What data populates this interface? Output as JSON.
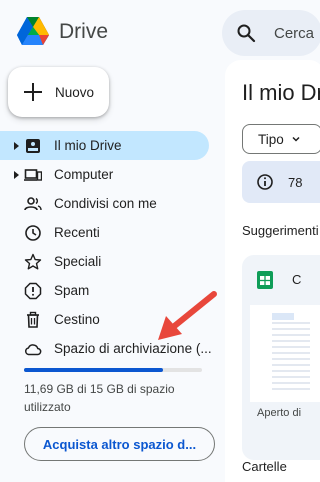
{
  "app": {
    "name": "Drive"
  },
  "new_button": {
    "label": "Nuovo"
  },
  "nav": {
    "items": [
      {
        "label": "Il mio Drive",
        "icon": "my-drive-icon",
        "active": true,
        "expandable": true
      },
      {
        "label": "Computer",
        "icon": "computer-icon",
        "active": false,
        "expandable": true
      },
      {
        "label": "Condivisi con me",
        "icon": "shared-icon",
        "active": false,
        "expandable": false
      },
      {
        "label": "Recenti",
        "icon": "clock-icon",
        "active": false,
        "expandable": false
      },
      {
        "label": "Speciali",
        "icon": "star-icon",
        "active": false,
        "expandable": false
      },
      {
        "label": "Spam",
        "icon": "spam-icon",
        "active": false,
        "expandable": false
      },
      {
        "label": "Cestino",
        "icon": "trash-icon",
        "active": false,
        "expandable": false
      },
      {
        "label": "Spazio di archiviazione (...",
        "icon": "cloud-icon",
        "active": false,
        "expandable": false
      }
    ]
  },
  "storage": {
    "text": "11,69 GB di 15 GB di spazio utilizzato",
    "used_fraction": 0.78,
    "buy_label": "Acquista altro spazio d..."
  },
  "search": {
    "placeholder": "Cerca"
  },
  "main": {
    "title": "Il mio Drive",
    "filter_chip": "Tipo",
    "info_text": "78",
    "suggested": "Suggerimenti",
    "card_title": "C",
    "card_opened": "Aperto di",
    "folders": "Cartelle"
  },
  "colors": {
    "active_bg": "#c2e7ff",
    "accent": "#0b57d0",
    "arrow": "#e8473b"
  }
}
